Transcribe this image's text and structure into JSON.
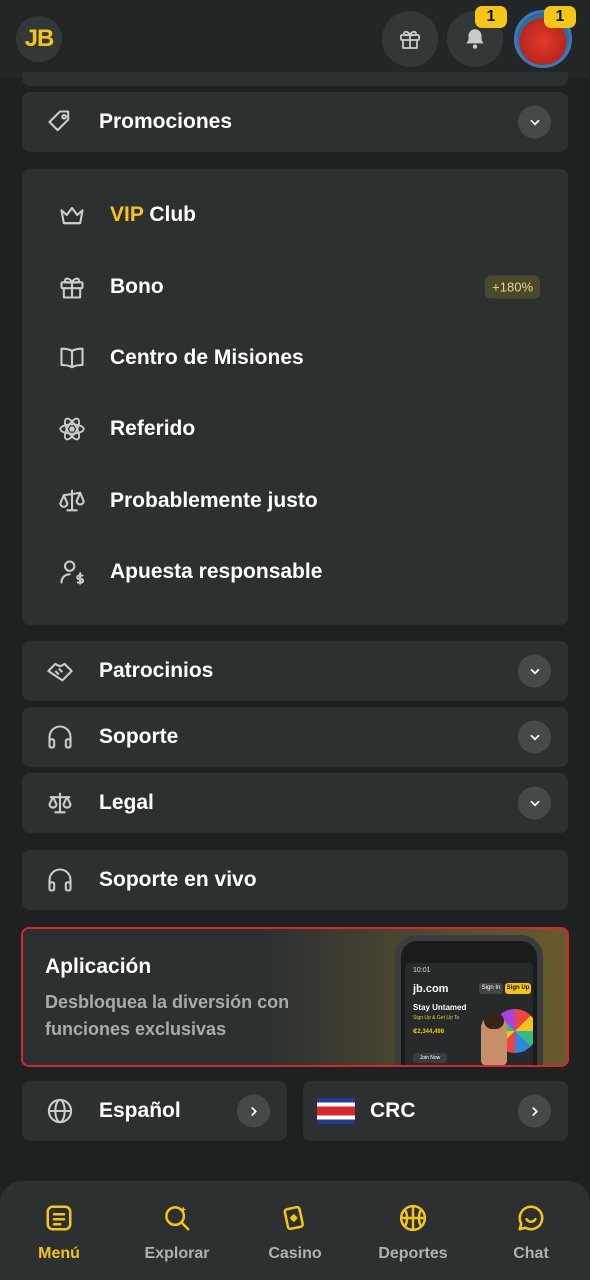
{
  "header": {
    "logo_text": "JB",
    "gift_icon": "gift-icon",
    "notifications_icon": "bell-icon",
    "notifications_badge": "1",
    "avatar_badge": "1"
  },
  "menu": {
    "promociones": "Promociones",
    "vip_prefix": "VIP",
    "vip_suffix": "Club",
    "bono": "Bono",
    "bono_badge": "+180%",
    "centro_misiones": "Centro de Misiones",
    "referido": "Referido",
    "probablemente_justo": "Probablemente justo",
    "apuesta_responsable": "Apuesta responsable",
    "patrocinios": "Patrocinios",
    "soporte": "Soporte",
    "legal": "Legal",
    "soporte_en_vivo": "Soporte en vivo"
  },
  "app_banner": {
    "title": "Aplicación",
    "subtitle": "Desbloquea la diversión con funciones exclusivas",
    "phone": {
      "time": "10:01",
      "logo": "jb.com",
      "sign_in": "Sign In",
      "sign_up": "Sign Up",
      "headline": "Stay Untamed",
      "promo": "Sign Up & Get Up To",
      "amount": "₡2,344,498",
      "join": "Join Now"
    }
  },
  "language": {
    "label": "Español"
  },
  "currency": {
    "label": "CRC"
  },
  "bottom_nav": {
    "menu": "Menú",
    "explorar": "Explorar",
    "casino": "Casino",
    "deportes": "Deportes",
    "chat": "Chat"
  },
  "colors": {
    "accent": "#f5c518",
    "background": "#1e2121",
    "card": "#2c3030",
    "highlight_border": "#d9252b"
  }
}
